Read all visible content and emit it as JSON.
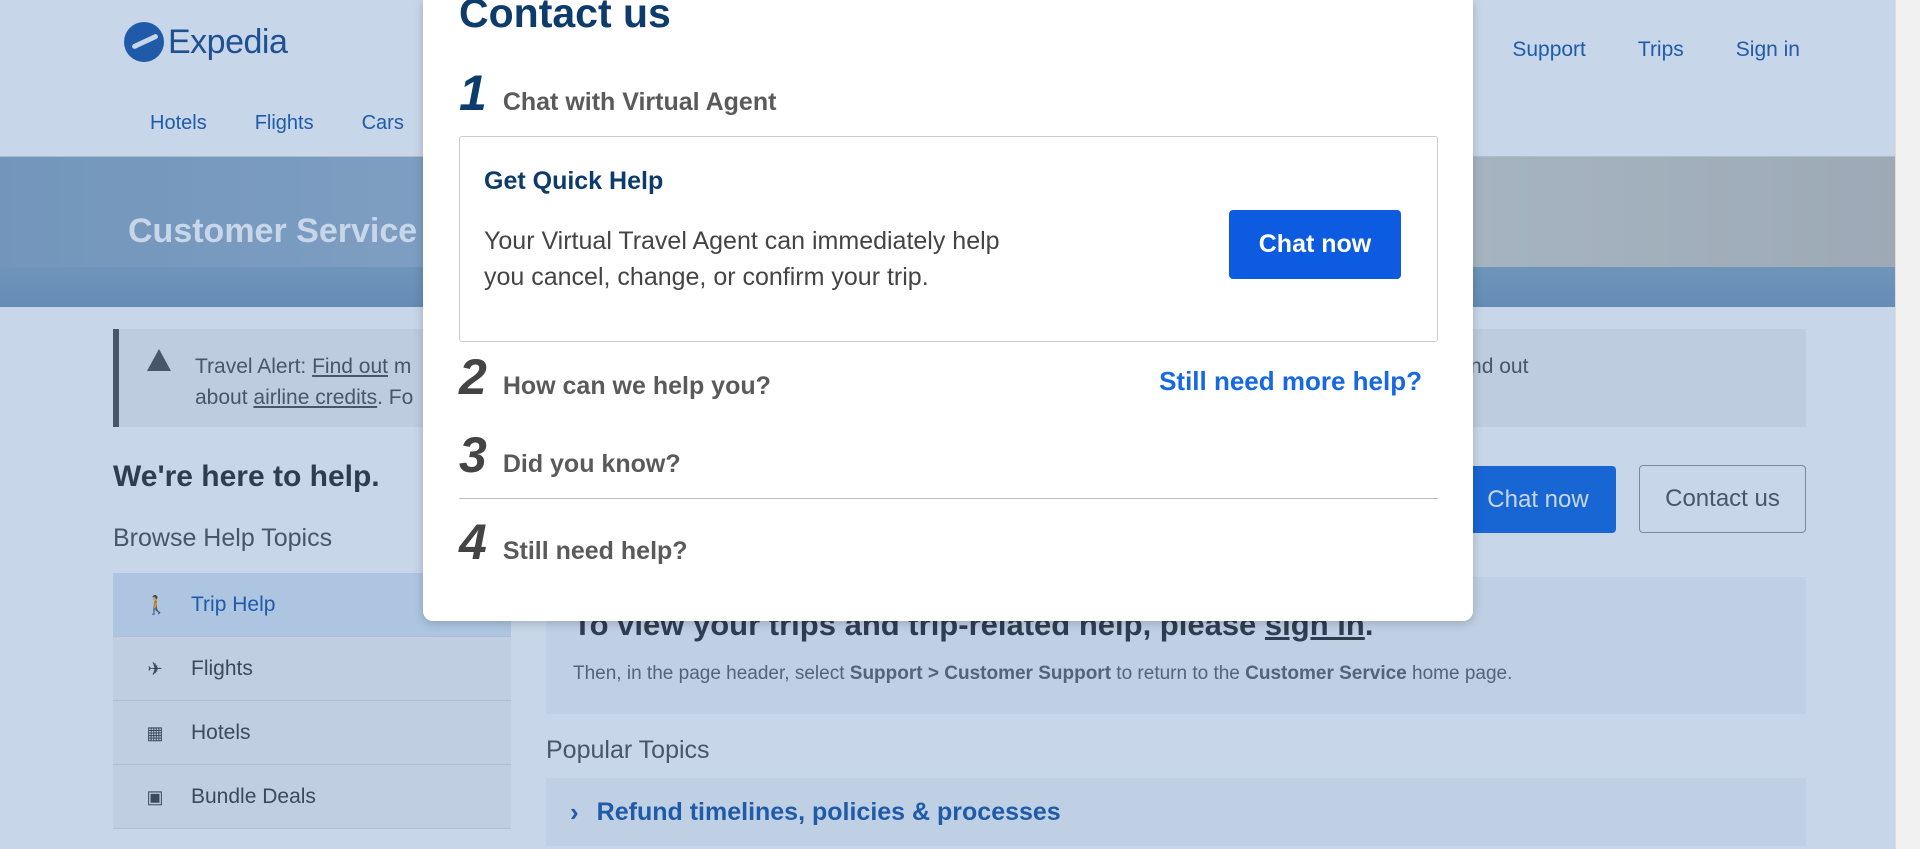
{
  "header": {
    "logo_text": "Expedia",
    "top_links": [
      "Support",
      "Trips",
      "Sign in"
    ],
    "nav_tabs": [
      "Hotels",
      "Flights",
      "Cars"
    ]
  },
  "hero": {
    "title": "Customer Service"
  },
  "alert": {
    "prefix": "Travel Alert: ",
    "link1": "Find out",
    "middle": " m",
    "tail_right": "this time or find out",
    "line2_prefix": "about ",
    "link2": "airline credits",
    "line2_suffix": ". Fo"
  },
  "left": {
    "heading": "We're here to help.",
    "browse_label": "Browse Help Topics",
    "topics": [
      {
        "label": "Trip Help",
        "icon": "person-walking-icon",
        "active": true
      },
      {
        "label": "Flights",
        "icon": "airplane-icon",
        "active": false
      },
      {
        "label": "Hotels",
        "icon": "hotel-building-icon",
        "active": false
      },
      {
        "label": "Bundle Deals",
        "icon": "luggage-icon",
        "active": false
      }
    ]
  },
  "main": {
    "chat_now": "Chat now",
    "contact_us": "Contact us",
    "signin_title_prefix": "To view your trips and trip-related help, please ",
    "signin_link": "sign in",
    "signin_title_suffix": ".",
    "signin_sub_1": "Then, in the page header, select ",
    "signin_sub_b1": "Support > Customer Support",
    "signin_sub_2": " to return to the ",
    "signin_sub_b2": "Customer Service",
    "signin_sub_3": " home page.",
    "popular_label": "Popular Topics",
    "popular_items": [
      "Refund timelines, policies & processes"
    ]
  },
  "modal": {
    "title": "Contact us",
    "steps": [
      {
        "num": "1",
        "label": "Chat with Virtual Agent"
      },
      {
        "num": "2",
        "label": "How can we help you?"
      },
      {
        "num": "3",
        "label": "Did you know?"
      },
      {
        "num": "4",
        "label": "Still need help?"
      }
    ],
    "quick_help": {
      "title": "Get Quick Help",
      "desc": "Your Virtual Travel Agent can immediately help you cancel, change, or confirm your trip.",
      "button": "Chat now"
    },
    "more_help_link": "Still need more help?"
  },
  "colors": {
    "brand_blue": "#1668e3",
    "dark_navy": "#0d3b6b",
    "overlay": "rgba(31,91,168,0.25)"
  }
}
